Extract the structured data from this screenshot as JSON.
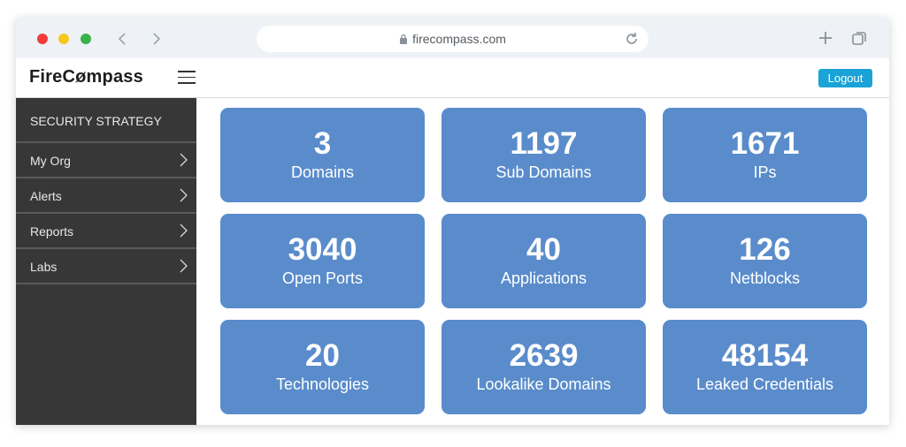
{
  "browser": {
    "url": "firecompass.com",
    "icons": {
      "back": "chevron-left-icon",
      "forward": "chevron-right-icon",
      "lock": "lock-icon",
      "reload": "reload-icon",
      "new_tab": "plus-icon",
      "tabs": "tabs-icon"
    },
    "colors": {
      "red": "#f23c3c",
      "yellow": "#f6c81c",
      "green": "#38b24a"
    }
  },
  "header": {
    "logo": {
      "part1": "FireC",
      "mark": "ø",
      "part2": "mpass"
    },
    "logout_label": "Logout",
    "accent": "#1aa3d6"
  },
  "sidebar": {
    "title": "SECURITY STRATEGY",
    "items": [
      {
        "label": "My Org"
      },
      {
        "label": "Alerts"
      },
      {
        "label": "Reports"
      },
      {
        "label": "Labs"
      }
    ]
  },
  "tiles": [
    {
      "value": "3",
      "label": "Domains"
    },
    {
      "value": "1197",
      "label": "Sub Domains"
    },
    {
      "value": "1671",
      "label": "IPs"
    },
    {
      "value": "3040",
      "label": "Open Ports"
    },
    {
      "value": "40",
      "label": "Applications"
    },
    {
      "value": "126",
      "label": "Netblocks"
    },
    {
      "value": "20",
      "label": "Technologies"
    },
    {
      "value": "2639",
      "label": "Lookalike Domains"
    },
    {
      "value": "48154",
      "label": "Leaked Credentials"
    }
  ],
  "tile_color": "#5a8ccb"
}
